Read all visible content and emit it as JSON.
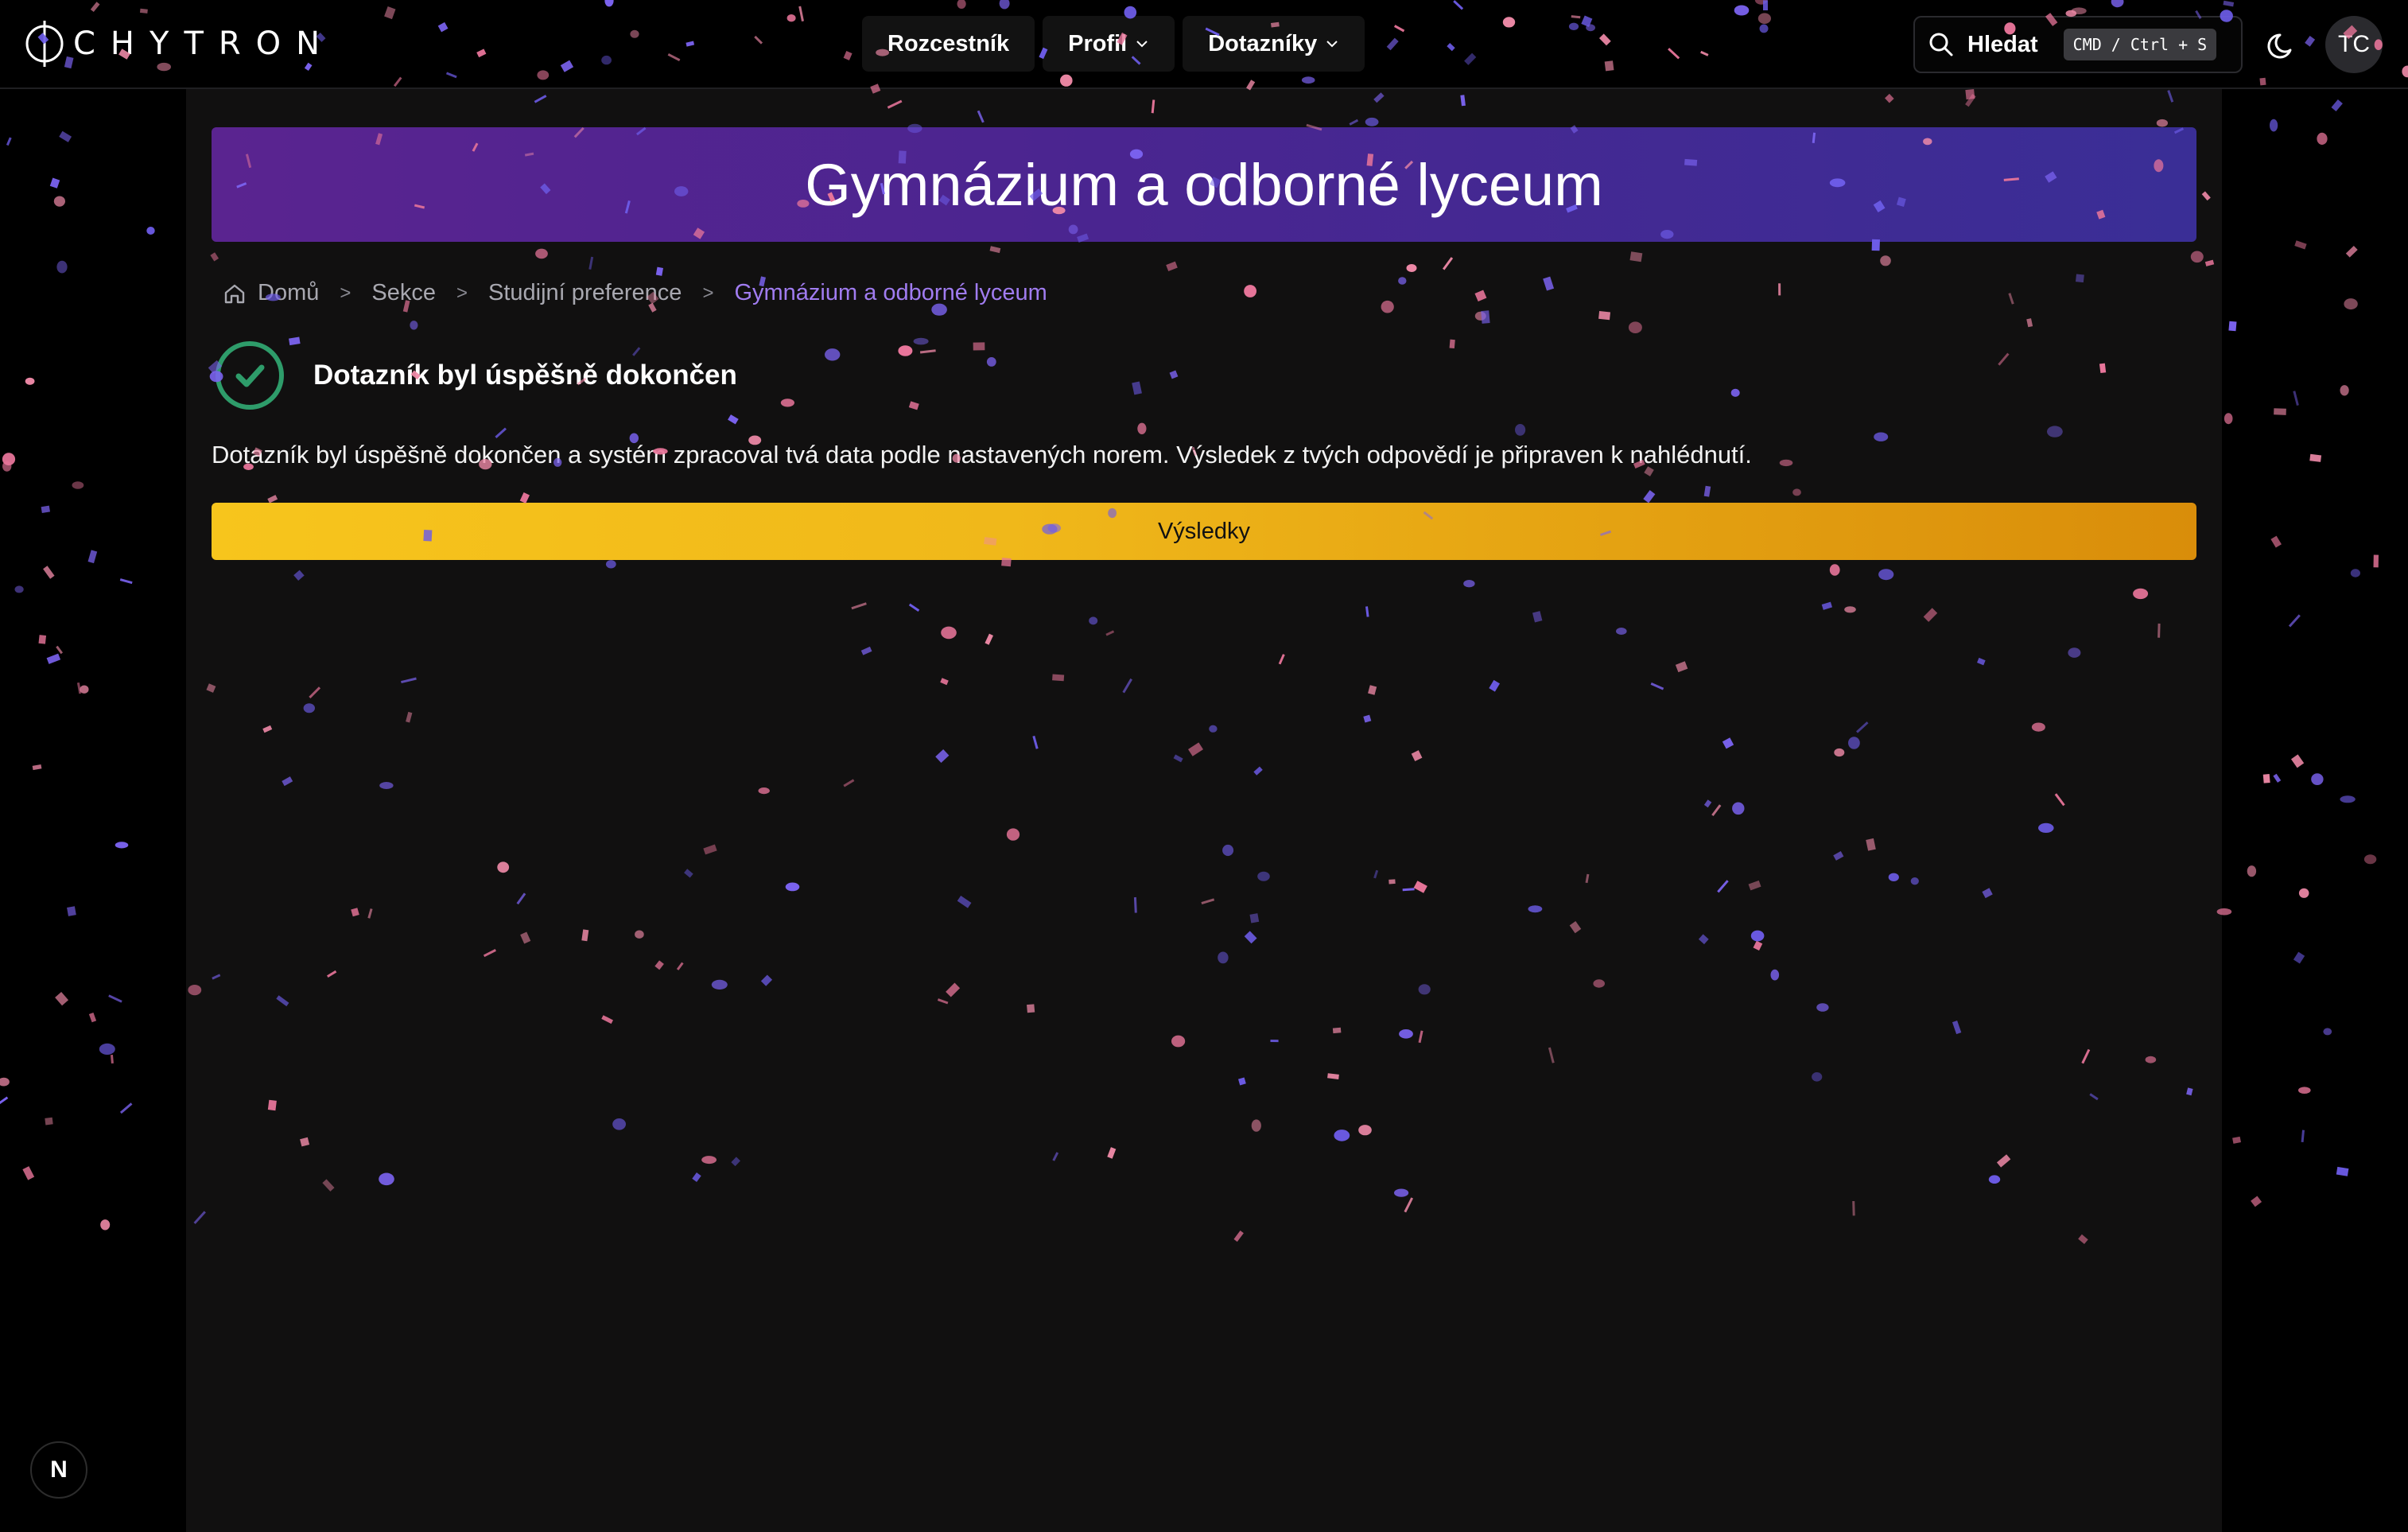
{
  "header": {
    "logo_text": "CHYTRON",
    "nav": [
      {
        "label": "Rozcestník"
      },
      {
        "label": "Profil"
      },
      {
        "label": "Dotazníky"
      }
    ],
    "search": {
      "label": "Hledat",
      "shortcut": "CMD / Ctrl + S"
    },
    "avatar_initials": "TC"
  },
  "banner": {
    "title": "Gymnázium a odborné lyceum"
  },
  "breadcrumb": [
    "Domů",
    "Sekce",
    "Studijní preference",
    "Gymnázium a odborné lyceum"
  ],
  "status": {
    "title": "Dotazník byl úspěšně dokončen",
    "description": "Dotazník byl úspěšně dokončen a systém zpracoval tvá data podle nastavených norem. Výsledek z tvých odpovědí je připraven k nahlédnutí."
  },
  "results_button": "Výsledky",
  "framework_badge": "N",
  "colors": {
    "banner_start": "#5a2490",
    "banner_end": "#3a2e96",
    "accent": "#a07cf0",
    "button_start": "#f7c51c",
    "button_end": "#d98d0a",
    "success": "#2e9c6a",
    "confetti_pink": "#e8759a",
    "confetti_violet": "#7b63f0"
  }
}
